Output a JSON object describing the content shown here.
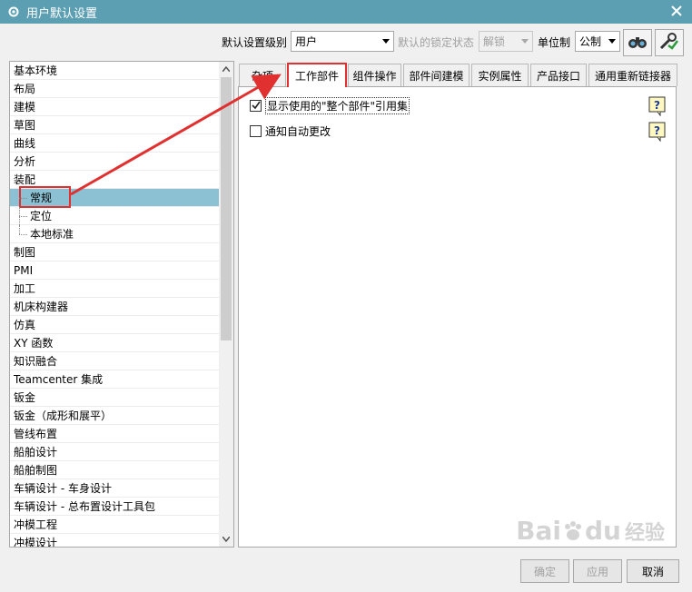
{
  "window": {
    "title": "用户默认设置",
    "title_bar_color": "#5c9fb3"
  },
  "toolbar": {
    "level_label": "默认设置级别",
    "level_value": "用户",
    "lock_label": "默认的锁定状态",
    "lock_value": "解锁",
    "unit_label": "单位制",
    "unit_value": "公制",
    "buttons": [
      "find-binoculars-icon",
      "manage-settings-icon"
    ]
  },
  "tree": {
    "items": [
      {
        "label": "基本环境"
      },
      {
        "label": "布局"
      },
      {
        "label": "建模"
      },
      {
        "label": "草图"
      },
      {
        "label": "曲线"
      },
      {
        "label": "分析"
      },
      {
        "label": "装配"
      },
      {
        "label": "常规",
        "child": true,
        "selected": true
      },
      {
        "label": "定位",
        "child": true
      },
      {
        "label": "本地标准",
        "child": true
      },
      {
        "label": "制图"
      },
      {
        "label": "PMI"
      },
      {
        "label": "加工"
      },
      {
        "label": "机床构建器"
      },
      {
        "label": "仿真"
      },
      {
        "label": "XY 函数"
      },
      {
        "label": "知识融合"
      },
      {
        "label": "Teamcenter 集成"
      },
      {
        "label": "钣金"
      },
      {
        "label": "钣金（成形和展平）"
      },
      {
        "label": "管线布置"
      },
      {
        "label": "船舶设计"
      },
      {
        "label": "船舶制图"
      },
      {
        "label": "车辆设计 - 车身设计"
      },
      {
        "label": "车辆设计 - 总布置设计工具包"
      },
      {
        "label": "冲模工程"
      },
      {
        "label": "冲模设计"
      }
    ],
    "selection_color": "#8cc1d4"
  },
  "tabs": [
    {
      "label": "杂项"
    },
    {
      "label": "工作部件",
      "active": true
    },
    {
      "label": "组件操作"
    },
    {
      "label": "部件间建模"
    },
    {
      "label": "实例属性"
    },
    {
      "label": "产品接口"
    },
    {
      "label": "通用重新链接器"
    }
  ],
  "options": [
    {
      "label": "显示使用的\"整个部件\"引用集",
      "checked": true
    },
    {
      "label": "通知自动更改",
      "checked": false
    }
  ],
  "buttons": {
    "ok": "确定",
    "apply": "应用",
    "cancel": "取消"
  },
  "annotation_color": "#e03030",
  "watermark": {
    "brand": "Bai",
    "brand2": "du",
    "suffix": "经验"
  }
}
